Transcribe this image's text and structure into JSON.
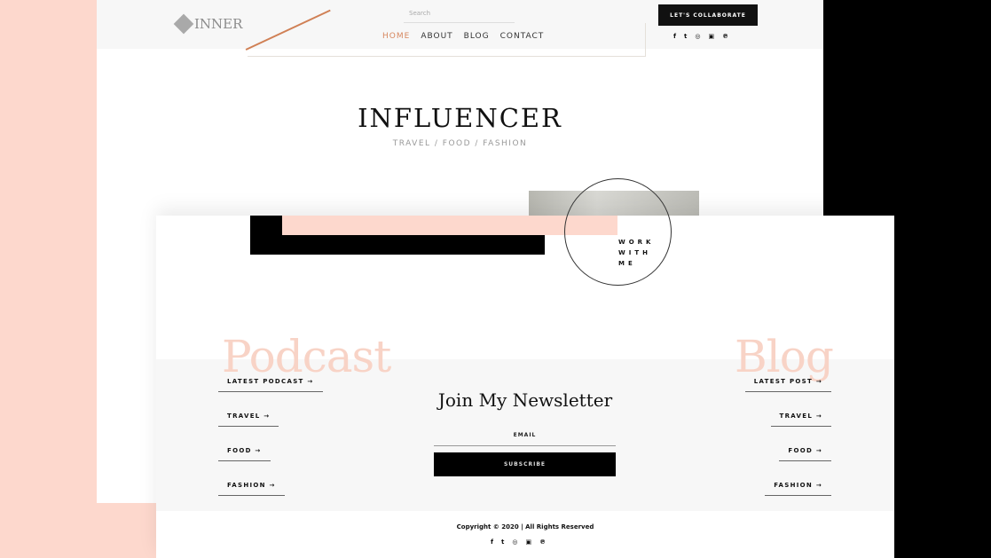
{
  "colors": {
    "accent": "#d7875f",
    "pink": "#fdd8cd",
    "dark": "#000000"
  },
  "header": {
    "logo": "INNER",
    "search_placeholder": "Search",
    "nav": [
      "HOME",
      "ABOUT",
      "BLOG",
      "CONTACT"
    ],
    "collab": "LET'S COLLABORATE",
    "social": [
      "f",
      "t",
      "ig",
      "yt",
      "p"
    ]
  },
  "hero": {
    "title": "INFLUENCER",
    "subtitle": "TRAVEL / FOOD / FASHION"
  },
  "work": "WORK WITH ME",
  "podcast": {
    "heading": "Podcast",
    "links": [
      "LATEST PODCAST →",
      "TRAVEL →",
      "FOOD →",
      "FASHION →"
    ]
  },
  "blog": {
    "heading": "Blog",
    "links": [
      "LATEST POST →",
      "TRAVEL →",
      "FOOD →",
      "FASHION →"
    ]
  },
  "newsletter": {
    "title": "Join My Newsletter",
    "email_placeholder": "EMAIL",
    "subscribe": "SUBSCRIBE"
  },
  "footer": {
    "copyright": "Copyright © 2020 | All Rights Reserved",
    "social": [
      "f",
      "t",
      "ig",
      "yt",
      "p"
    ]
  }
}
